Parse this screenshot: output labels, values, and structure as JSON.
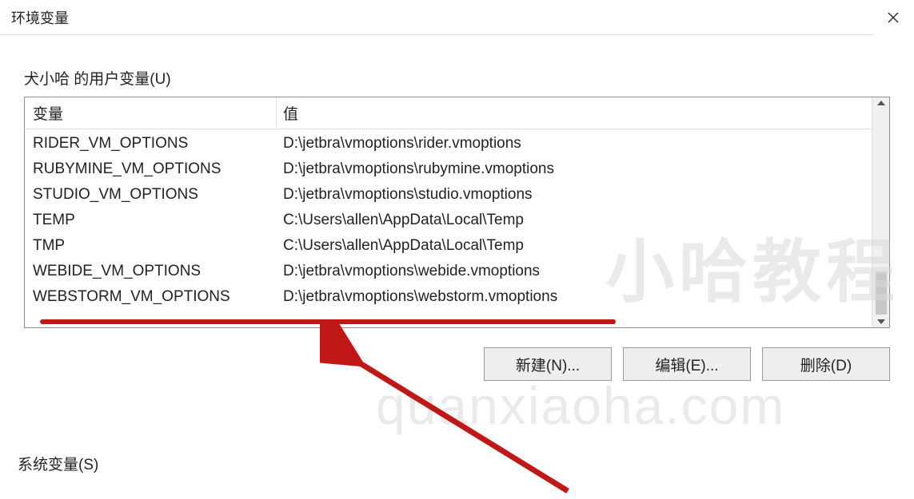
{
  "window": {
    "title": "环境变量"
  },
  "user_vars": {
    "label": "犬小哈 的用户变量(U)",
    "columns": {
      "name": "变量",
      "value": "值"
    },
    "rows": [
      {
        "name": "RIDER_VM_OPTIONS",
        "value": "D:\\jetbra\\vmoptions\\rider.vmoptions"
      },
      {
        "name": "RUBYMINE_VM_OPTIONS",
        "value": "D:\\jetbra\\vmoptions\\rubymine.vmoptions"
      },
      {
        "name": "STUDIO_VM_OPTIONS",
        "value": "D:\\jetbra\\vmoptions\\studio.vmoptions"
      },
      {
        "name": "TEMP",
        "value": "C:\\Users\\allen\\AppData\\Local\\Temp"
      },
      {
        "name": "TMP",
        "value": "C:\\Users\\allen\\AppData\\Local\\Temp"
      },
      {
        "name": "WEBIDE_VM_OPTIONS",
        "value": "D:\\jetbra\\vmoptions\\webide.vmoptions"
      },
      {
        "name": "WEBSTORM_VM_OPTIONS",
        "value": "D:\\jetbra\\vmoptions\\webstorm.vmoptions"
      }
    ]
  },
  "buttons": {
    "new": "新建(N)...",
    "edit": "编辑(E)...",
    "delete": "删除(D)"
  },
  "system_vars": {
    "label": "系统变量(S)"
  },
  "watermarks": {
    "top": "小哈教程",
    "bottom": "quanxiaoha.com"
  }
}
